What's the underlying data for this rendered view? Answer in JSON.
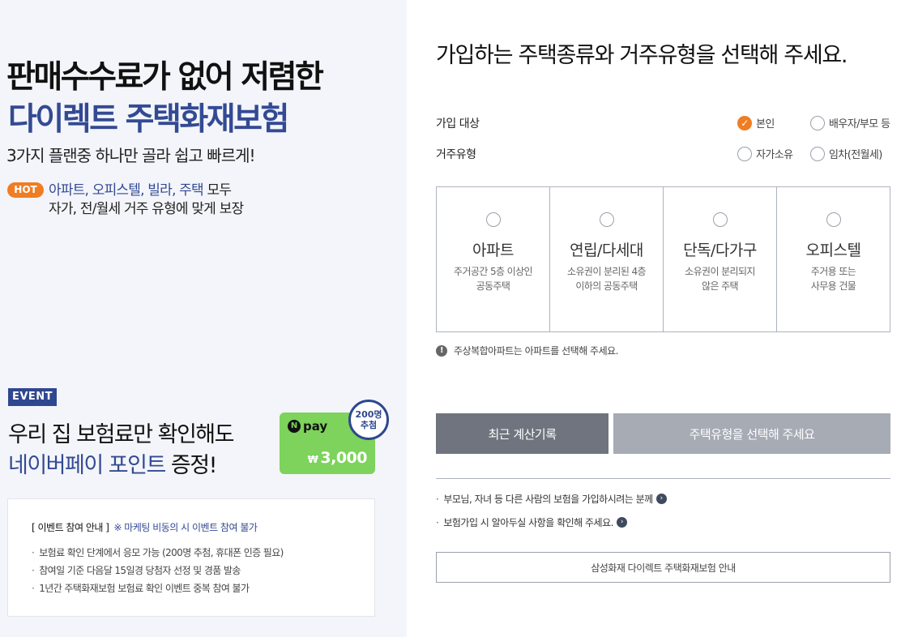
{
  "hero": {
    "line1": "판매수수료가 없어 저렴한",
    "line2": "다이렉트 주택화재보험",
    "subtitle": "3가지 플랜중 하나만 골라 쉽고 빠르게!",
    "hot_badge": "HOT",
    "hot_types": "아파트, 오피스텔, 빌라, 주택",
    "hot_suffix": " 모두",
    "hot_line2": "자가, 전/월세 거주 유형에 맞게 보장"
  },
  "event": {
    "badge": "EVENT",
    "title_line1": "우리 집 보험료만 확인해도",
    "title_line2_highlight": "네이버페이 포인트",
    "title_line2_suffix": " 증정!",
    "npay_n": "N",
    "npay_word": "pay",
    "npay_currency": "₩",
    "npay_amount": "3,000",
    "stamp_line1": "200명",
    "stamp_line2": "추첨",
    "notice_head": "[ 이벤트 참여 안내 ]",
    "notice_marketing": "※ 마케팅 비동의 시 이벤트 참여 불가",
    "notice_items": [
      "보험료 확인 단계에서 응모 가능 (200명 추첨, 휴대폰 인증 필요)",
      "참여일 기준 다음달 15일경 당첨자 선정 및 경품 발송",
      "1년간 주택화재보험 보험료 확인 이벤트 중복 참여 불가"
    ]
  },
  "form": {
    "title": "가입하는 주택종류와 거주유형을 선택해 주세요.",
    "target_label": "가입 대상",
    "target_options": [
      "본인",
      "배우자/부모 등"
    ],
    "target_selected": "본인",
    "residence_label": "거주유형",
    "residence_options": [
      "자가소유",
      "임차(전월세)"
    ],
    "house_types": [
      {
        "title": "아파트",
        "desc1": "주거공간 5층 이상인",
        "desc2": "공동주택"
      },
      {
        "title": "연립/다세대",
        "desc1": "소유권이 분리된 4층",
        "desc2": "이하의 공동주택"
      },
      {
        "title": "단독/다가구",
        "desc1": "소유권이 분리되지",
        "desc2": "않은 주택"
      },
      {
        "title": "오피스텔",
        "desc1": "주거용 또는",
        "desc2": "사무용 건물"
      }
    ],
    "info_note": "주상복합아파트는 아파트를 선택해 주세요.",
    "btn_recent": "최근 계산기록",
    "btn_select": "주택유형을 선택해 주세요",
    "link1": "부모님, 자녀 등 다른 사람의 보험을 가입하시려는 분께",
    "link2": "보험가입 시 알아두실 사항을 확인해 주세요.",
    "btn_guide": "삼성화재 다이렉트 주택화재보험 안내"
  },
  "colors": {
    "accent_orange": "#f07d22",
    "brand_blue": "#334a93",
    "npay_green": "#7dd35b",
    "left_bg": "#f3f5fa"
  },
  "icons": {
    "checked_radio": "check-icon",
    "info": "exclamation-icon",
    "link_arrow": "chevron-right-icon"
  }
}
